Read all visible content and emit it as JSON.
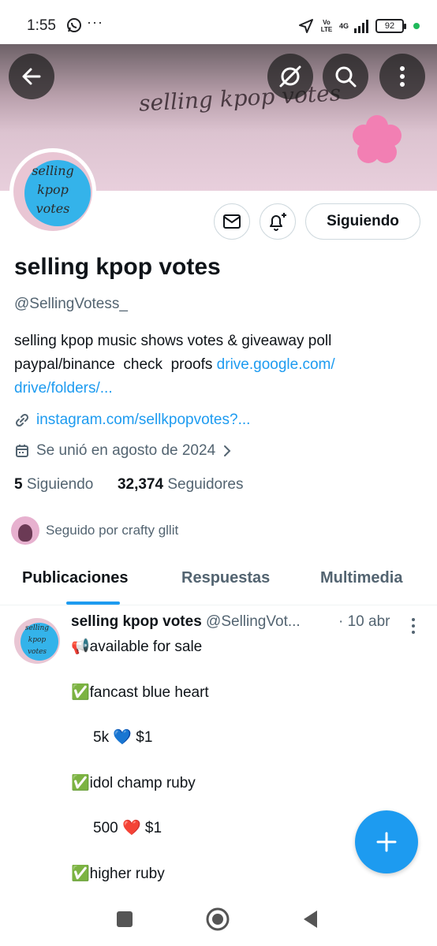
{
  "status_bar": {
    "time": "1:55",
    "dots": "···",
    "network": "4G",
    "volte": "Vo LTE",
    "battery": "92"
  },
  "banner": {
    "text": "selling kpop votes"
  },
  "avatar": {
    "line1": "selling",
    "line2": "kpop",
    "line3": "votes"
  },
  "profile": {
    "follow_label": "Siguiendo",
    "name": "selling kpop votes",
    "handle": "@SellingVotess_",
    "bio_line1": "selling kpop music shows votes & giveaway poll",
    "bio_line2_text": "paypal/binance  check  proofs ",
    "bio_link_1": "drive.google.com/",
    "bio_link_2": "drive/folders/...",
    "website": "instagram.com/sellkpopvotes?...",
    "joined": "Se unió en agosto de 2024",
    "following_count": "5",
    "following_label": "Siguiendo",
    "followers_count": "32,374",
    "followers_label": "Seguidores",
    "followed_by": "Seguido por crafty gllit"
  },
  "tabs": [
    {
      "label": "Publicaciones",
      "active": true
    },
    {
      "label": "Respuestas",
      "active": false
    },
    {
      "label": "Multimedia",
      "active": false
    }
  ],
  "post": {
    "author": "selling kpop votes",
    "handle": "@SellingVot...",
    "date": "· 10 abr",
    "avatar_line1": "selling",
    "avatar_line2": "kpop",
    "avatar_line3": "votes",
    "lines": [
      "📢available for sale",
      "✅fancast  blue heart",
      "5k 💙 $1",
      "✅idol champ  ruby",
      "500 ❤️ $1",
      "✅higher  ruby"
    ]
  },
  "colors": {
    "accent": "#1d9bf0",
    "text": "#0f1419",
    "muted": "#536471"
  }
}
